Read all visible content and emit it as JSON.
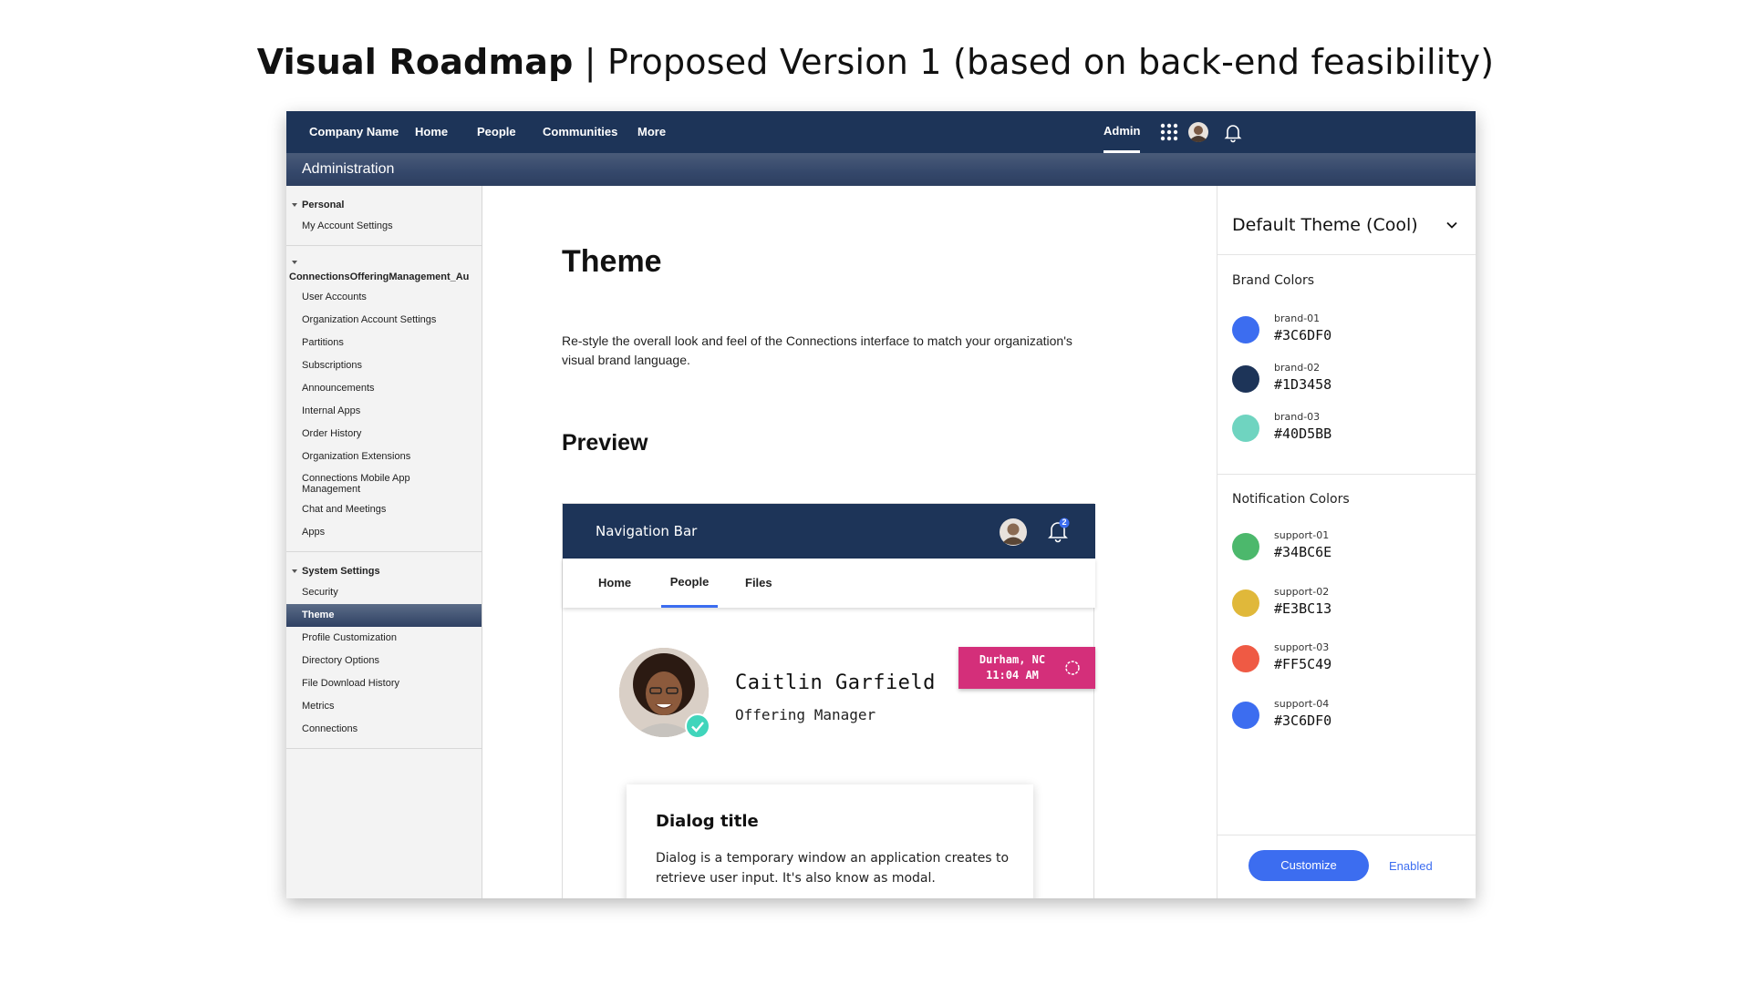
{
  "slide": {
    "title_strong": "Visual Roadmap",
    "title_rest": " | Proposed Version 1 (based on back-end feasibility)"
  },
  "topnav": {
    "items": [
      "Company Name",
      "Home",
      "People",
      "Communities",
      "More"
    ],
    "admin": "Admin",
    "icons": [
      "apps-grid-icon",
      "user-avatar",
      "bell-icon"
    ]
  },
  "subbar": {
    "title": "Administration"
  },
  "sidebar": {
    "groups": [
      {
        "title": "Personal",
        "items": [
          "My Account Settings"
        ]
      },
      {
        "title": "ConnectionsOfferingManagement_Au",
        "items": [
          "User Accounts",
          "Organization Account Settings",
          "Partitions",
          "Subscriptions",
          "Announcements",
          "Internal Apps",
          "Order History",
          "Organization Extensions",
          "Connections Mobile App Management",
          "Chat and Meetings",
          "Apps"
        ]
      },
      {
        "title": "System Settings",
        "items": [
          "Security",
          "Theme",
          "Profile Customization",
          "Directory Options",
          "File Download History",
          "Metrics",
          "Connections"
        ]
      }
    ],
    "active": "Theme"
  },
  "main": {
    "heading": "Theme",
    "description": "Re-style the overall look and feel of the Connections interface to match your organization's visual brand language.",
    "preview_heading": "Preview",
    "preview": {
      "nav_label": "Navigation Bar",
      "notification_count": "2",
      "tabs": [
        "Home",
        "People",
        "Files"
      ],
      "active_tab": "People",
      "name": "Caitlin Garfield",
      "role": "Offering Manager",
      "location": "Durham, NC",
      "time": "11:04 AM",
      "dialog_title": "Dialog title",
      "dialog_body": "Dialog is a temporary window an application creates to retrieve user input. It's also know as modal."
    }
  },
  "right_panel": {
    "theme_value": "Default Theme (Cool)",
    "brand_label": "Brand Colors",
    "brand_colors": [
      {
        "token": "brand-01",
        "hex": "#3C6DF0",
        "color": "#3c6df0"
      },
      {
        "token": "brand-02",
        "hex": "#1D3458",
        "color": "#1d3458"
      },
      {
        "token": "brand-03",
        "hex": "#40D5BB",
        "color": "#6fd4c0"
      }
    ],
    "notification_label": "Notification Colors",
    "notification_colors": [
      {
        "token": "support-01",
        "hex": "#34BC6E",
        "color": "#4cb86c"
      },
      {
        "token": "support-02",
        "hex": "#E3BC13",
        "color": "#e0b83a"
      },
      {
        "token": "support-03",
        "hex": "#FF5C49",
        "color": "#ef5a44"
      },
      {
        "token": "support-04",
        "hex": "#3C6DF0",
        "color": "#3c6df0"
      }
    ],
    "customize_label": "Customize",
    "status": "Enabled"
  },
  "colors": {
    "nav_bg": "#1d3458",
    "accent": "#3c6df0",
    "badge": "#d42f7a"
  }
}
